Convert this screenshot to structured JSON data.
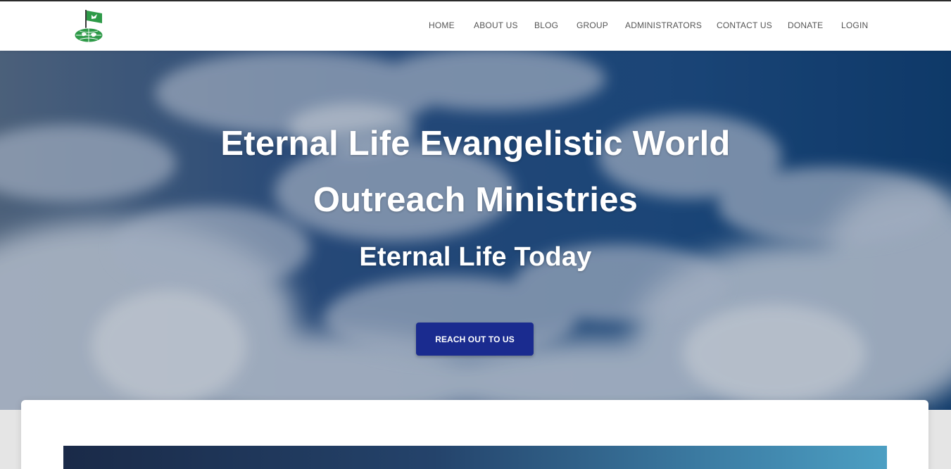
{
  "site": {
    "logo_icon": "ministry-globe-flag-logo",
    "brand_green": "#2e9a48"
  },
  "nav": {
    "items": [
      {
        "label": "HOME"
      },
      {
        "label": "ABOUT US"
      },
      {
        "label": "BLOG"
      },
      {
        "label": "GROUP"
      },
      {
        "label": "ADMINISTRATORS"
      },
      {
        "label": "CONTACT US"
      },
      {
        "label": "DONATE"
      },
      {
        "label": "LOGIN"
      }
    ]
  },
  "hero": {
    "title_line1": "Eternal Life Evangelistic World",
    "title_line2": "Outreach Ministries",
    "subtitle": "Eternal Life Today",
    "cta_label": "REACH OUT TO US",
    "cta_color": "#1a2b8f",
    "background": "cloudy-blue-sky"
  }
}
